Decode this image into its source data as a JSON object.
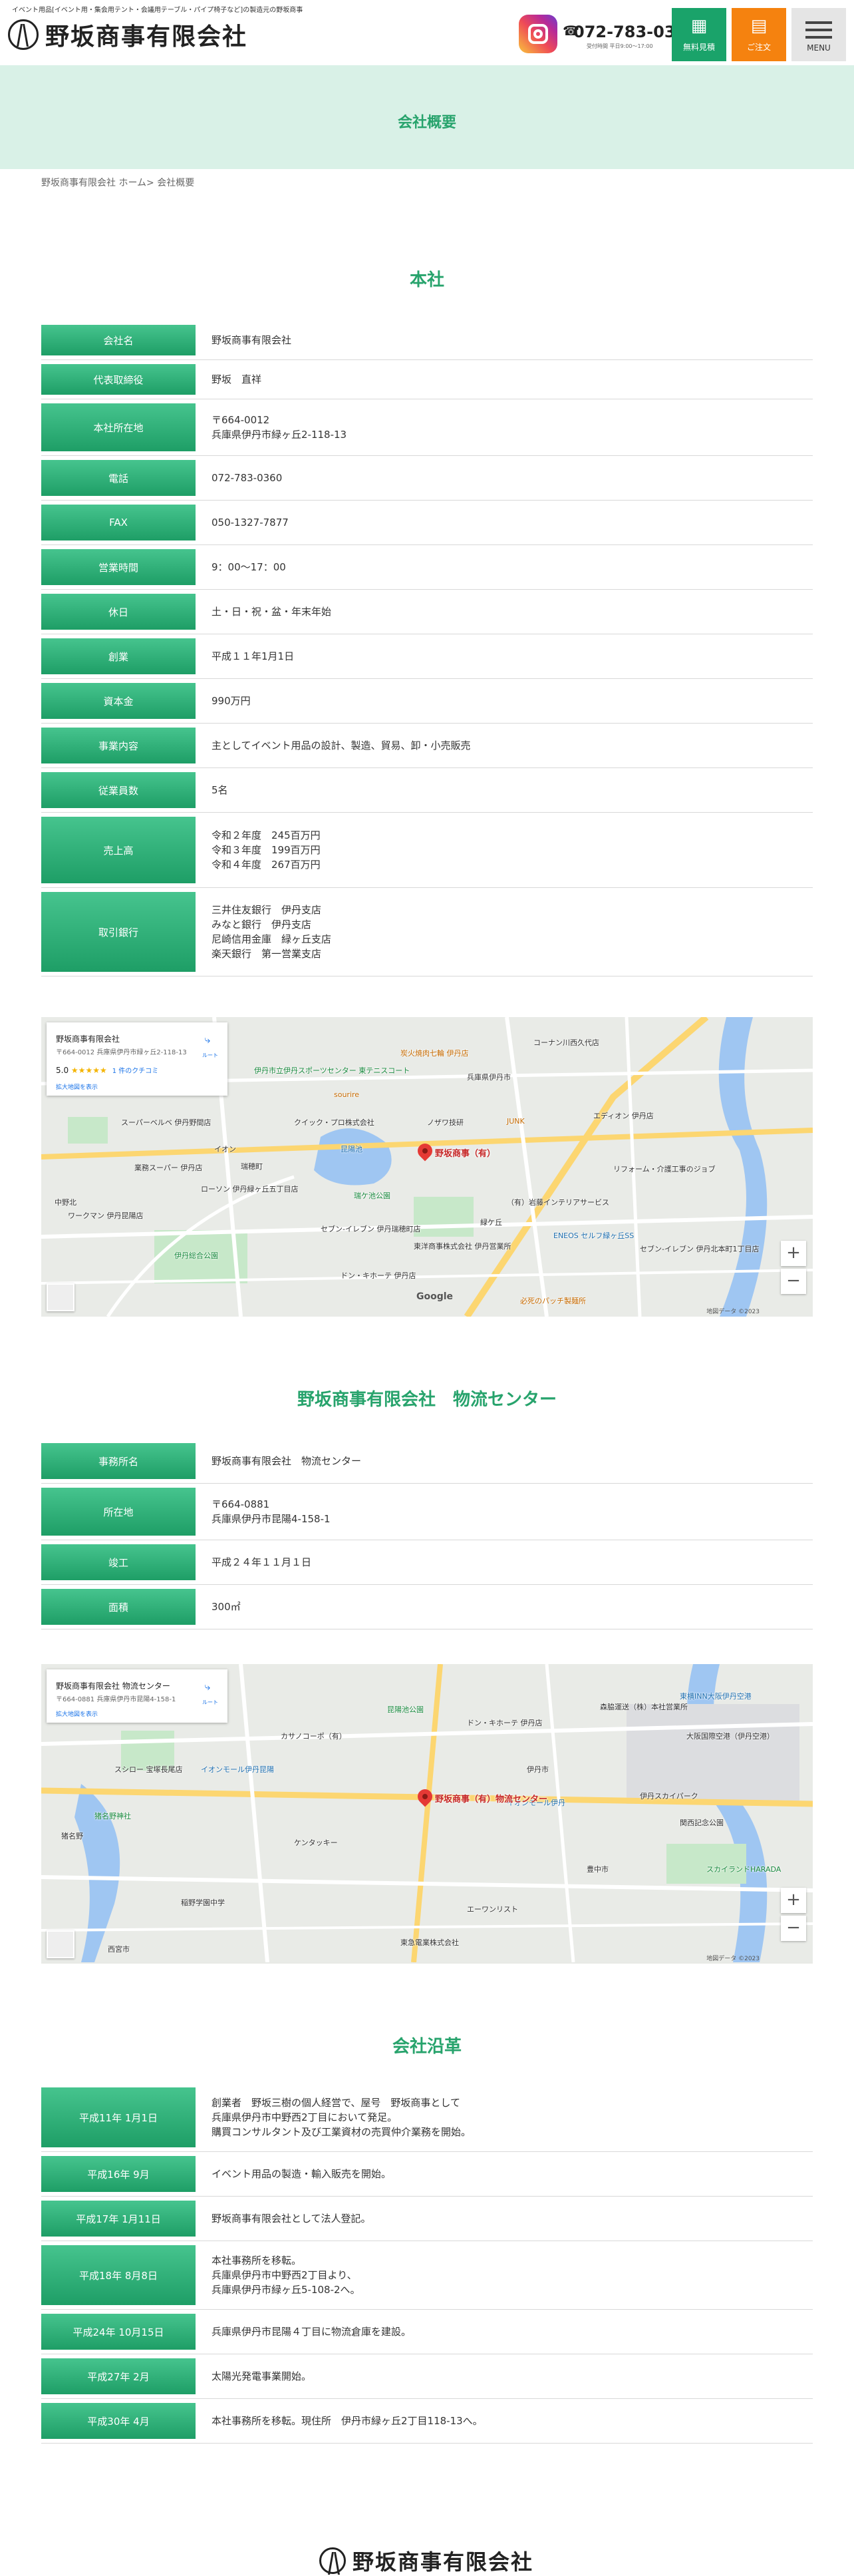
{
  "header": {
    "tagline": "イベント用品[イベント用・集会用テント・会議用テーブル・パイプ椅子など]の製造元の野坂商事",
    "logo_text": "野坂商事有限会社",
    "tel_icon": "phone-icon",
    "tel": "072-783-0360",
    "tel_hours": "受付時間 平日9:00〜17:00",
    "buttons": {
      "estimate": "無料見積",
      "order": "ご注文",
      "menu": "MENU"
    }
  },
  "page_title": "会社概要",
  "breadcrumb": {
    "home": "野坂商事有限会社 ホーム",
    "sep": ">",
    "current": "会社概要"
  },
  "head_office": {
    "title": "本社",
    "rows": [
      {
        "label": "会社名",
        "value": "野坂商事有限会社"
      },
      {
        "label": "代表取締役",
        "value": "野坂　直祥"
      },
      {
        "label": "本社所在地",
        "value": "〒664-0012\n兵庫県伊丹市緑ヶ丘2-118-13"
      },
      {
        "label": "電話",
        "value": "072-783-0360"
      },
      {
        "label": "FAX",
        "value": "050-1327-7877"
      },
      {
        "label": "営業時間",
        "value": "9：00〜17：00"
      },
      {
        "label": "休日",
        "value": "土・日・祝・盆・年末年始"
      },
      {
        "label": "創業",
        "value": "平成１１年1月1日"
      },
      {
        "label": "資本金",
        "value": "990万円"
      },
      {
        "label": "事業内容",
        "value": "主としてイベント用品の設計、製造、貿易、卸・小売販売"
      },
      {
        "label": "従業員数",
        "value": "5名"
      },
      {
        "label": "売上高",
        "value": "令和２年度　245百万円\n令和３年度　199百万円\n令和４年度　267百万円"
      },
      {
        "label": "取引銀行",
        "value": "三井住友銀行　伊丹支店\nみなと銀行　伊丹支店\n尼崎信用金庫　緑ヶ丘支店\n楽天銀行　第一営業支店"
      }
    ],
    "map": {
      "card_name": "野坂商事有限会社",
      "card_addr": "〒664-0012 兵庫県伊丹市緑ヶ丘2-118-13",
      "rating": "5.0",
      "stars": "★★★★★",
      "reviews": "1 件のクチコミ",
      "bigger": "拡大地図を表示",
      "directions": "ルート",
      "pin_label": "野坂商事（有）",
      "copyright": "地図データ ©2023",
      "labels": [
        "コーナン川西久代店",
        "炭火焼肉七輪 伊丹店",
        "伊丹市立伊丹スポーツセンター 東テニスコート",
        "兵庫県伊丹市",
        "sourire",
        "JUNK",
        "クイック・プロ株式会社",
        "ノザワ技研",
        "昆陽池",
        "エディオン 伊丹店",
        "スーパーベルベ 伊丹野間店",
        "業務スーパー 伊丹店",
        "ローソン 伊丹緑ヶ丘五丁目店",
        "瑞ケ池公園",
        "リフォーム・介護工事のジョブ",
        "（有）岩藤インテリアサービス",
        "ENEOS セルフ緑ヶ丘SS",
        "セブン-イレブン 伊丹北本町1丁目店",
        "ワークマン 伊丹昆陽店",
        "伊丹総合公園",
        "ドン・キホーテ 伊丹店",
        "中野北",
        "必死のパッチ製麺所",
        "東洋商事株式会社 伊丹営業所",
        "セブン-イレブン 伊丹瑞穂町店",
        "瑞穂町",
        "緑ケ丘",
        "イオン"
      ]
    }
  },
  "logistics": {
    "title": "野坂商事有限会社　物流センター",
    "rows": [
      {
        "label": "事務所名",
        "value": "野坂商事有限会社　物流センター"
      },
      {
        "label": "所在地",
        "value": "〒664-0881\n兵庫県伊丹市昆陽4-158-1"
      },
      {
        "label": "竣工",
        "value": "平成２４年１１月１日"
      },
      {
        "label": "面積",
        "value": "300㎡"
      }
    ],
    "map": {
      "card_name": "野坂商事有限会社 物流センター",
      "card_addr": "〒664-0881 兵庫県伊丹市昆陽4-158-1",
      "bigger": "拡大地図を表示",
      "directions": "ルート",
      "pin_label": "野坂商事（有）物流センター",
      "copyright": "地図データ ©2023",
      "labels": [
        "東横INN大阪伊丹空港",
        "森脇運送（株）本社営業所",
        "大阪国際空港（伊丹空港）",
        "昆陽池公園",
        "ドン・キホーテ 伊丹店",
        "伊丹市",
        "カサノコーポ（有）",
        "スシロー 宝塚長尾店",
        "イオンモール伊丹昆陽",
        "イオンモール伊丹",
        "伊丹スカイパーク",
        "猪名野神社",
        "猪名野",
        "ケンタッキー",
        "関西記念公園",
        "スカイランドHARADA",
        "エーワンリスト",
        "稲野学園中学",
        "東急電業株式会社",
        "豊中市",
        "西宮市"
      ]
    }
  },
  "history": {
    "title": "会社沿革",
    "rows": [
      {
        "label": "平成11年 1月1日",
        "value": "創業者　野坂三樹の個人経営で、屋号　野坂商事として\n兵庫県伊丹市中野西2丁目において発足。\n購買コンサルタント及び工業資材の売買仲介業務を開始。"
      },
      {
        "label": "平成16年 9月",
        "value": "イベント用品の製造・輸入販売を開始。"
      },
      {
        "label": "平成17年 1月11日",
        "value": "野坂商事有限会社として法人登記。"
      },
      {
        "label": "平成18年 8月8日",
        "value": "本社事務所を移転。\n兵庫県伊丹市中野西2丁目より、\n兵庫県伊丹市緑ヶ丘5-108-2へ。"
      },
      {
        "label": "平成24年 10月15日",
        "value": "兵庫県伊丹市昆陽４丁目に物流倉庫を建設。"
      },
      {
        "label": "平成27年 2月",
        "value": "太陽光発電事業開始。"
      },
      {
        "label": "平成30年 4月",
        "value": "本社事務所を移転。現住所　伊丹市緑ヶ丘2丁目118-13へ。"
      }
    ]
  },
  "footer": {
    "logo_text": "野坂商事有限会社"
  },
  "colors": {
    "accent": "#27a36c",
    "estimate_btn": "#1aa36a",
    "order_btn": "#f5820f",
    "title_bg": "#d9f1e7"
  }
}
